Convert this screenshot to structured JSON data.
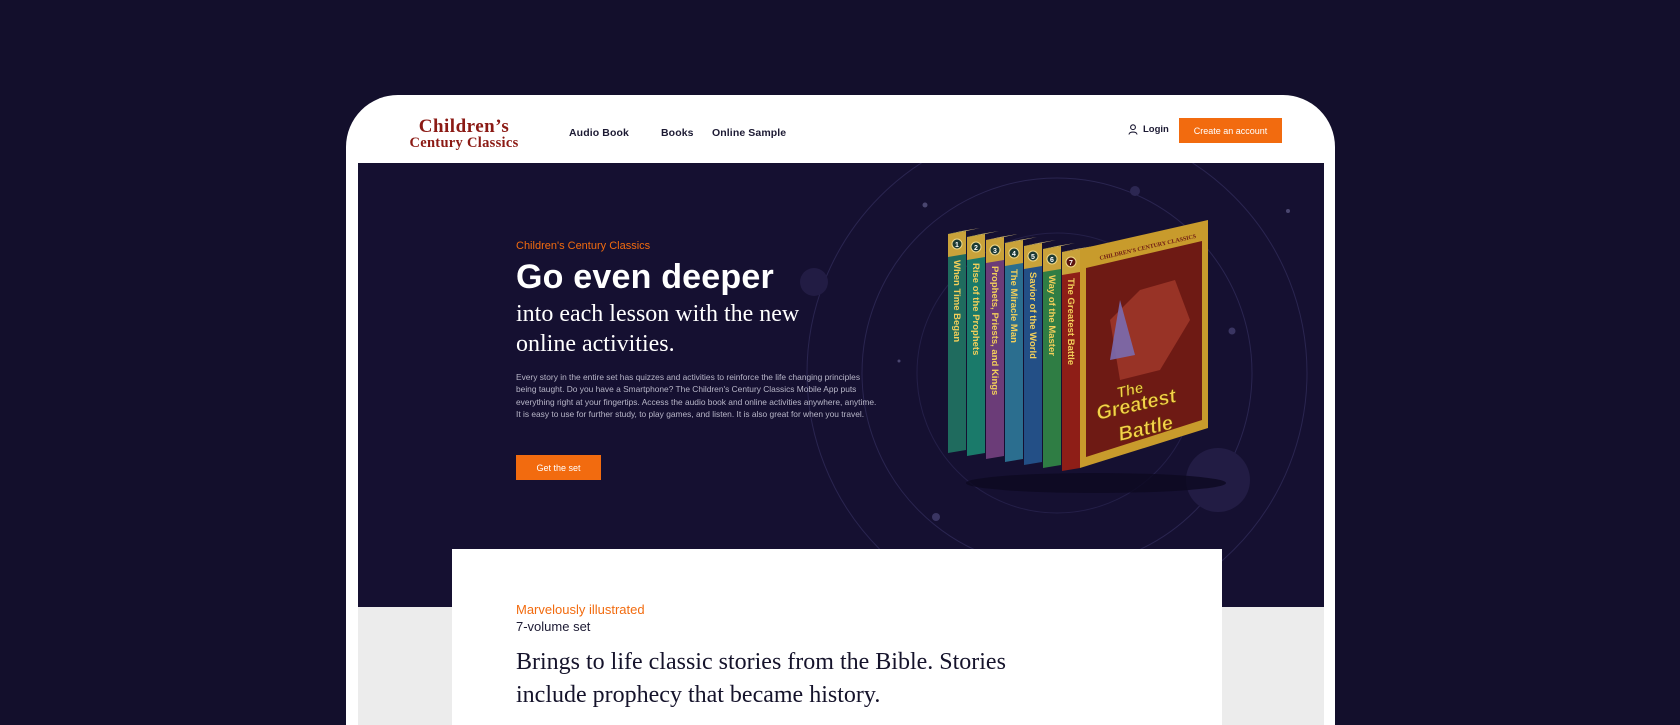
{
  "brand": {
    "logo_line1": "Children’s",
    "logo_line2": "Century Classics"
  },
  "nav": {
    "items": [
      "Audio Book",
      "Books",
      "Online Sample"
    ],
    "login_label": "Login",
    "create_account_label": "Create an account"
  },
  "hero": {
    "eyebrow": "Children's Century Classics",
    "title": "Go even deeper",
    "subtitle": "into each lesson with the new online activities.",
    "body": "Every story in the entire set has quizzes and activities to reinforce the life changing principles being taught. Do you have a Smartphone? The Children's Century Classics Mobile App puts everything right at your fingertips. Access the audio book and online activities anywhere, anytime. It is easy to use for further study, to play games, and listen. It is also great for when you travel.",
    "button_label": "Get the set"
  },
  "books": {
    "spines": [
      {
        "number": "1",
        "title": "When Time Began",
        "color": "#1f6b5e"
      },
      {
        "number": "2",
        "title": "Rise of the Prophets",
        "color": "#1a7a6a"
      },
      {
        "number": "3",
        "title": "Prophets, Priests, and Kings",
        "color": "#6b3c78"
      },
      {
        "number": "4",
        "title": "The Miracle Man",
        "color": "#2b6e8f"
      },
      {
        "number": "5",
        "title": "Savior of the World",
        "color": "#234f86"
      },
      {
        "number": "6",
        "title": "Way of the Master",
        "color": "#2f7d44"
      }
    ],
    "front": {
      "number": "7",
      "spine_title": "The Greatest Battle",
      "cover_brand": "CHILDREN'S CENTURY CLASSICS",
      "cover_title_line1": "The",
      "cover_title_line2": "Greatest",
      "cover_title_line3": "Battle",
      "color": "#8e1e17"
    }
  },
  "section": {
    "eyebrow": "Marvelously illustrated",
    "subtitle": "7-volume set",
    "text": "Brings to life classic stories from the Bible. Stories include prophecy that became history."
  },
  "colors": {
    "background": "#130f2c",
    "hero_background": "#151031",
    "accent": "#f26b0f",
    "logo": "#8b1a14",
    "band": "#ececec"
  }
}
